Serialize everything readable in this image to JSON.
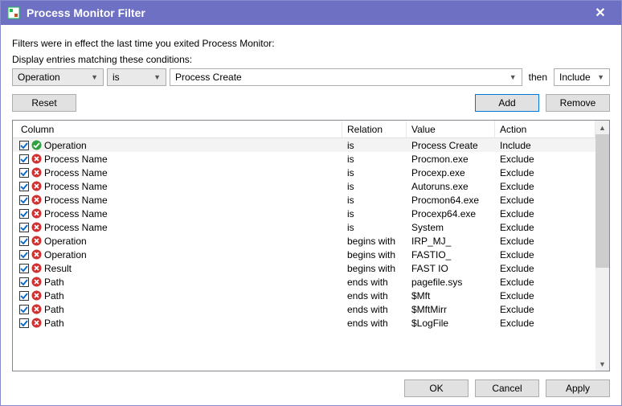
{
  "titlebar": {
    "title": "Process Monitor Filter"
  },
  "desc": "Filters were in effect the last time you exited Process Monitor:",
  "cond_label": "Display entries matching these conditions:",
  "cond": {
    "column": "Operation",
    "relation": "is",
    "value": "Process Create",
    "then_label": "then",
    "action": "Include"
  },
  "buttons": {
    "reset": "Reset",
    "add": "Add",
    "remove": "Remove",
    "ok": "OK",
    "cancel": "Cancel",
    "apply": "Apply"
  },
  "headers": {
    "column": "Column",
    "relation": "Relation",
    "value": "Value",
    "action": "Action"
  },
  "rows": [
    {
      "checked": true,
      "icon": "include",
      "column": "Operation",
      "relation": "is",
      "value": "Process Create",
      "action": "Include",
      "selected": true
    },
    {
      "checked": true,
      "icon": "exclude",
      "column": "Process Name",
      "relation": "is",
      "value": "Procmon.exe",
      "action": "Exclude"
    },
    {
      "checked": true,
      "icon": "exclude",
      "column": "Process Name",
      "relation": "is",
      "value": "Procexp.exe",
      "action": "Exclude"
    },
    {
      "checked": true,
      "icon": "exclude",
      "column": "Process Name",
      "relation": "is",
      "value": "Autoruns.exe",
      "action": "Exclude"
    },
    {
      "checked": true,
      "icon": "exclude",
      "column": "Process Name",
      "relation": "is",
      "value": "Procmon64.exe",
      "action": "Exclude"
    },
    {
      "checked": true,
      "icon": "exclude",
      "column": "Process Name",
      "relation": "is",
      "value": "Procexp64.exe",
      "action": "Exclude"
    },
    {
      "checked": true,
      "icon": "exclude",
      "column": "Process Name",
      "relation": "is",
      "value": "System",
      "action": "Exclude"
    },
    {
      "checked": true,
      "icon": "exclude",
      "column": "Operation",
      "relation": "begins with",
      "value": "IRP_MJ_",
      "action": "Exclude"
    },
    {
      "checked": true,
      "icon": "exclude",
      "column": "Operation",
      "relation": "begins with",
      "value": "FASTIO_",
      "action": "Exclude"
    },
    {
      "checked": true,
      "icon": "exclude",
      "column": "Result",
      "relation": "begins with",
      "value": "FAST IO",
      "action": "Exclude"
    },
    {
      "checked": true,
      "icon": "exclude",
      "column": "Path",
      "relation": "ends with",
      "value": "pagefile.sys",
      "action": "Exclude"
    },
    {
      "checked": true,
      "icon": "exclude",
      "column": "Path",
      "relation": "ends with",
      "value": "$Mft",
      "action": "Exclude"
    },
    {
      "checked": true,
      "icon": "exclude",
      "column": "Path",
      "relation": "ends with",
      "value": "$MftMirr",
      "action": "Exclude"
    },
    {
      "checked": true,
      "icon": "exclude",
      "column": "Path",
      "relation": "ends with",
      "value": "$LogFile",
      "action": "Exclude"
    }
  ]
}
